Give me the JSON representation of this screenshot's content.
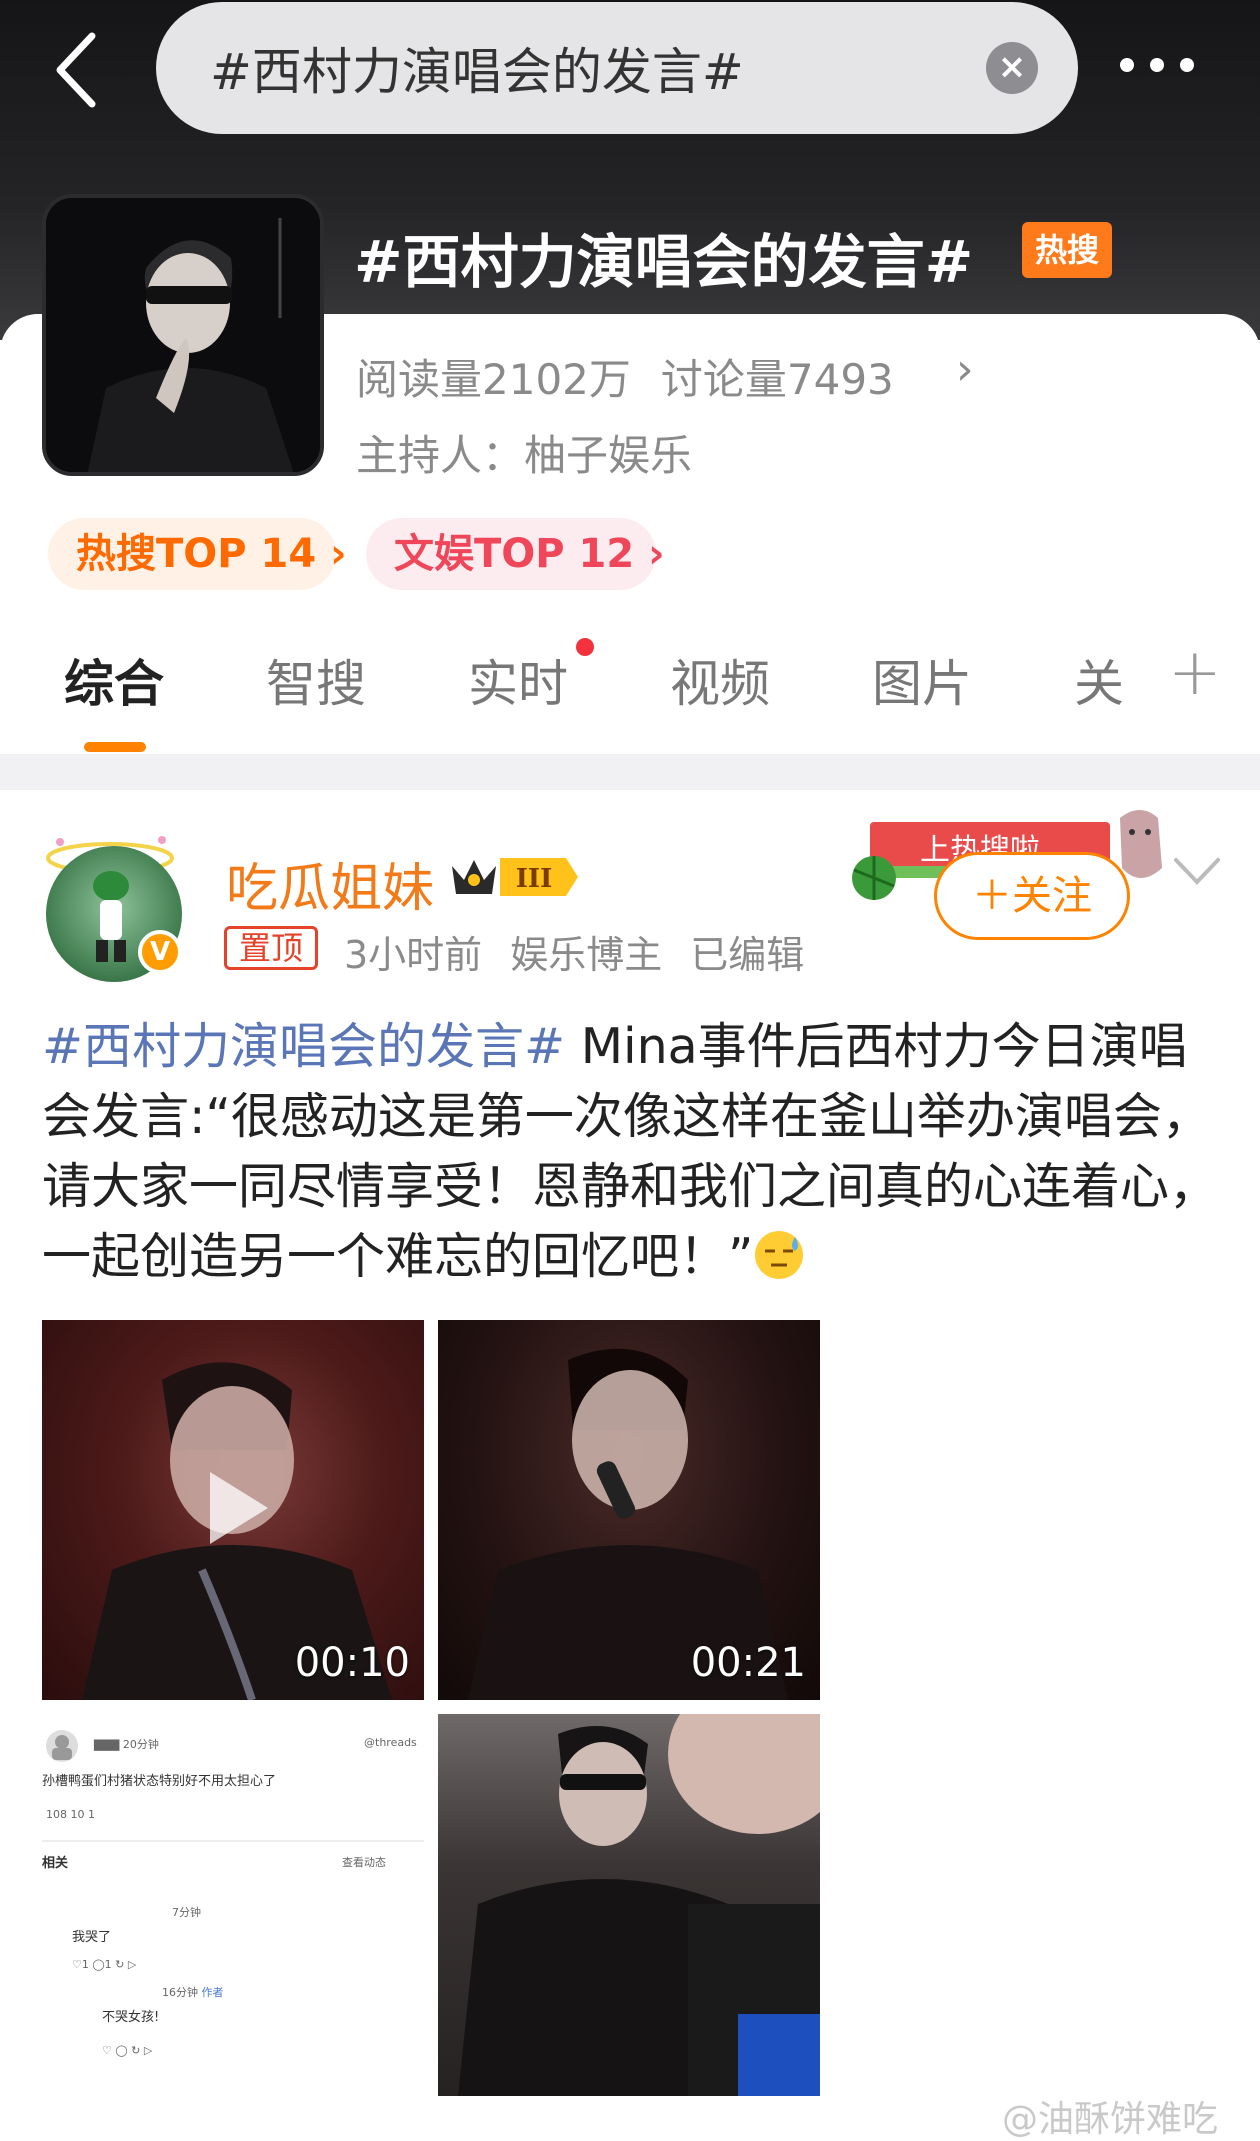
{
  "search": {
    "query": "#西村力演唱会的发言#"
  },
  "topic": {
    "title": "#西村力演唱会的发言#",
    "hot_badge": "热搜",
    "reads": "阅读量2102万",
    "discussions": "讨论量7493",
    "host": "主持人：柚子娱乐",
    "rank_hot": "热搜TOP 14",
    "rank_ent": "文娱TOP 12"
  },
  "tabs": [
    {
      "label": "综合"
    },
    {
      "label": "智搜"
    },
    {
      "label": "实时"
    },
    {
      "label": "视频"
    },
    {
      "label": "图片"
    },
    {
      "label": "关"
    }
  ],
  "post": {
    "user_name": "吃瓜姐妹",
    "level": "III",
    "pin_label": "置顶",
    "time": "3小时前",
    "role": "娱乐博主",
    "edited": "已编辑",
    "sticker_text": "上热搜啦",
    "follow_label": "关注",
    "hashtag": "#西村力演唱会的发言#",
    "body": " Mina事件后西村力今日演唱会发言:“很感动这是第一次像这样在釜山举办演唱会，请大家一同尽情享受！恩静和我们之间真的心连着心，一起创造另一个难忘的回忆吧！”",
    "media": [
      {
        "type": "video",
        "duration": "00:10"
      },
      {
        "type": "video",
        "duration": "00:21"
      },
      {
        "type": "image"
      },
      {
        "type": "image"
      }
    ],
    "screenshot": {
      "time1": "20分钟",
      "brand": "threads",
      "line1": "孙槽鸭蛋们村猪状态特别好不用太担心了",
      "stats": "108   10        1",
      "related": "相关",
      "view_more": "查看动态",
      "time2": "7分钟",
      "reply1": "我哭了",
      "time3": "16分钟",
      "author_tag": "作者",
      "reply2": "不哭女孩!"
    }
  },
  "watermark": "@油酥饼难吃"
}
